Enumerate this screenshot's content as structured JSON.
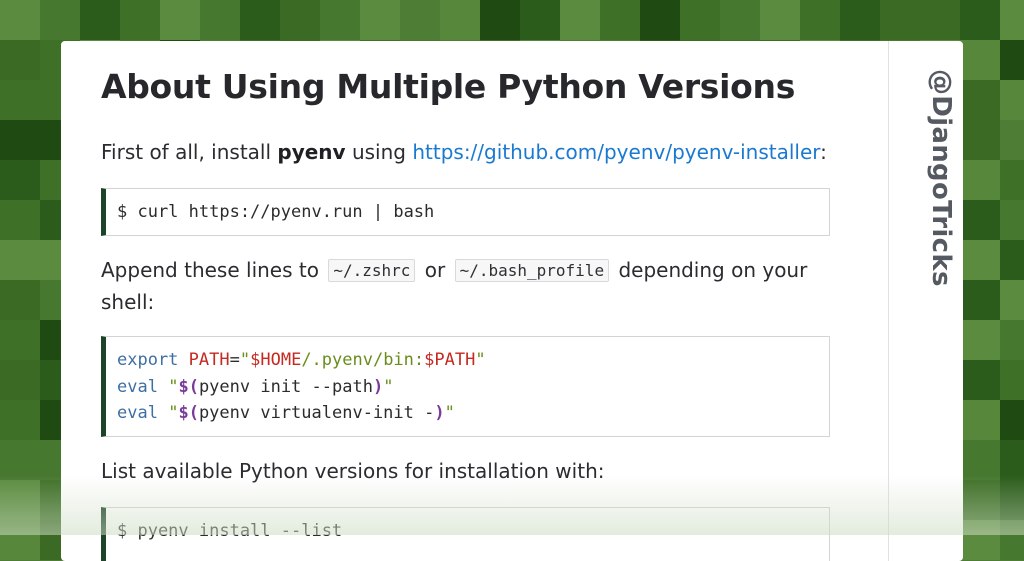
{
  "colors": {
    "page_background_green": "#4e7d35",
    "code_block_accent": "#1d4429",
    "link": "#1a7ad1",
    "brand_text": "#555961",
    "syntax_keyword": "#3e6fa3",
    "syntax_variable": "#c5291f",
    "syntax_string": "#6a8d1c",
    "syntax_punctuation": "#7a3a9a"
  },
  "article": {
    "title": "About Using Multiple Python Versions",
    "para1": {
      "before": "First of all, install ",
      "strong": "pyenv",
      "middle": " using ",
      "link": "https://github.com/pyenv/pyenv-installer",
      "after": ":"
    },
    "code1": {
      "line1": "$ curl https://pyenv.run | bash"
    },
    "para2": {
      "before": "Append these lines to",
      "code_a": "~/.zshrc",
      "middle": "or",
      "code_b": "~/.bash_profile",
      "after": "depending on your shell:"
    },
    "code2": {
      "line1": {
        "kw": "export",
        "sp": " ",
        "var": "PATH",
        "eq": "=",
        "q1": "\"",
        "v1": "$HOME",
        "s1": "/.pyenv/bin:",
        "v2": "$PATH",
        "q2": "\""
      },
      "line2": {
        "kw": "eval",
        "sp": " ",
        "q1": "\"",
        "open": "$(",
        "cmd": "pyenv init --path",
        "close": ")",
        "q2": "\""
      },
      "line3": {
        "kw": "eval",
        "sp": " ",
        "q1": "\"",
        "open": "$(",
        "cmd": "pyenv virtualenv-init -",
        "close": ")",
        "q2": "\""
      }
    },
    "para3": "List available Python versions for installation with:",
    "code3": {
      "line1": "$ pyenv install --list"
    }
  },
  "sidebar": {
    "brand": "@DjangoTricks"
  }
}
